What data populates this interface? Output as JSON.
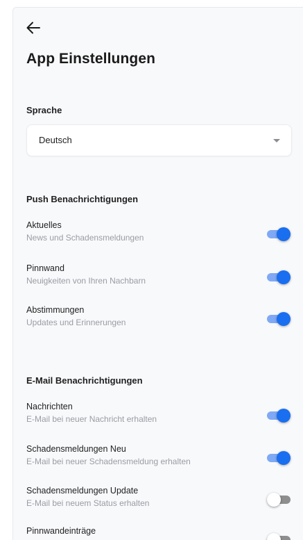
{
  "header": {
    "back_icon": "arrow-left-icon",
    "title": "App Einstellungen"
  },
  "language": {
    "label": "Sprache",
    "selected": "Deutsch",
    "caret_icon": "caret-down-icon"
  },
  "push": {
    "label": "Push Benachrichtigungen",
    "items": [
      {
        "title": "Aktuelles",
        "subtitle": "News und Schadensmeldungen",
        "enabled": true
      },
      {
        "title": "Pinnwand",
        "subtitle": "Neuigkeiten von Ihren Nachbarn",
        "enabled": true
      },
      {
        "title": "Abstimmungen",
        "subtitle": "Updates und Erinnerungen",
        "enabled": true
      }
    ]
  },
  "email": {
    "label": "E-Mail Benachrichtigungen",
    "items": [
      {
        "title": "Nachrichten",
        "subtitle": "E-Mail bei neuer Nachricht erhalten",
        "enabled": true
      },
      {
        "title": "Schadensmeldungen Neu",
        "subtitle": "E-Mail bei neuer Schadensmeldung erhalten",
        "enabled": true
      },
      {
        "title": "Schadensmeldungen Update",
        "subtitle": "E-Mail bei neuem Status erhalten",
        "enabled": false
      },
      {
        "title": "Pinnwandeinträge",
        "subtitle": "",
        "enabled": false
      }
    ]
  },
  "colors": {
    "toggle_on": "#1a6ef0",
    "toggle_on_track": "#7fa9f5",
    "toggle_off_track": "#8e8e8e",
    "background": "#f8f9fb"
  }
}
